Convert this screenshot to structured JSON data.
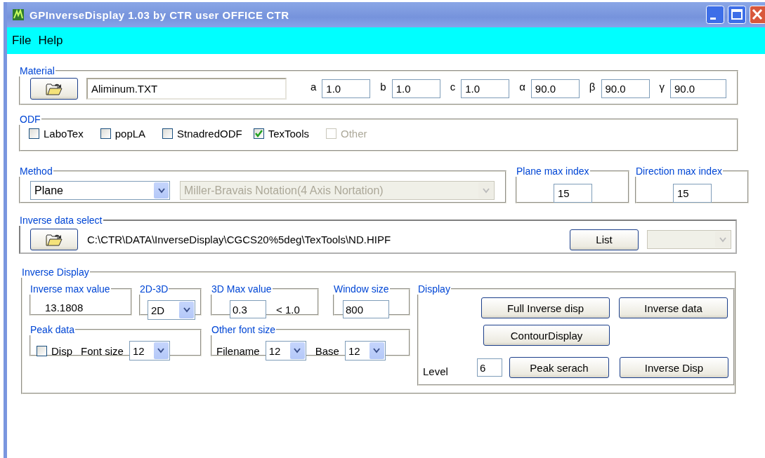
{
  "window": {
    "title": "GPInverseDisplay 1.03 by CTR user OFFICE CTR"
  },
  "menu": [
    "File",
    "Help"
  ],
  "material": {
    "legend": "Material",
    "file": "Aliminum.TXT",
    "params": [
      {
        "label": "a",
        "value": "1.0"
      },
      {
        "label": "b",
        "value": "1.0"
      },
      {
        "label": "c",
        "value": "1.0"
      },
      {
        "label": "α",
        "value": "90.0"
      },
      {
        "label": "β",
        "value": "90.0"
      },
      {
        "label": "γ",
        "value": "90.0"
      }
    ]
  },
  "odf": {
    "legend": "ODF",
    "options": [
      {
        "label": "LaboTex",
        "checked": false,
        "disabled": false
      },
      {
        "label": "popLA",
        "checked": false,
        "disabled": false
      },
      {
        "label": "StnadredODF",
        "checked": false,
        "disabled": false
      },
      {
        "label": "TexTools",
        "checked": true,
        "disabled": false
      },
      {
        "label": "Other",
        "checked": false,
        "disabled": true
      }
    ]
  },
  "method": {
    "legend": "Method",
    "type": "Plane",
    "notation": {
      "value": "Miller-Bravais Notation(4 Axis Nortation)",
      "disabled": true
    }
  },
  "plane_max_index": {
    "legend": "Plane max index",
    "value": "15"
  },
  "direction_max_index": {
    "legend": "Direction max index",
    "value": "15"
  },
  "inverse_data_select": {
    "legend": "Inverse data select",
    "path": "C:\\CTR\\DATA\\InverseDisplay\\CGCS20%5deg\\TexTools\\ND.HIPF",
    "list_button": "List"
  },
  "inverse_display": {
    "legend": "Inverse Display",
    "max_value": {
      "legend": "Inverse max value",
      "value": "13.1808"
    },
    "dimension": {
      "legend": "2D-3D",
      "value": "2D"
    },
    "max_3d": {
      "legend": "3D Max value",
      "value": "0.3",
      "limit": "< 1.0"
    },
    "window_size": {
      "legend": "Window size",
      "value": "800"
    },
    "peak_data": {
      "legend": "Peak data",
      "disp_label": "Disp",
      "disp_checked": false,
      "font_label": "Font size",
      "font_size": "12"
    },
    "other_font_size": {
      "legend": "Other font size",
      "filename_label": "Filename",
      "filename_size": "12",
      "base_label": "Base",
      "base_size": "12"
    },
    "display": {
      "legend": "Display",
      "full_inverse_button": "Full Inverse disp",
      "inverse_data_button": "Inverse data",
      "contour_button": "ContourDisplay",
      "level_label": "Level",
      "level_value": "6",
      "peak_search_button": "Peak serach",
      "inverse_disp_button": "Inverse Disp"
    }
  }
}
